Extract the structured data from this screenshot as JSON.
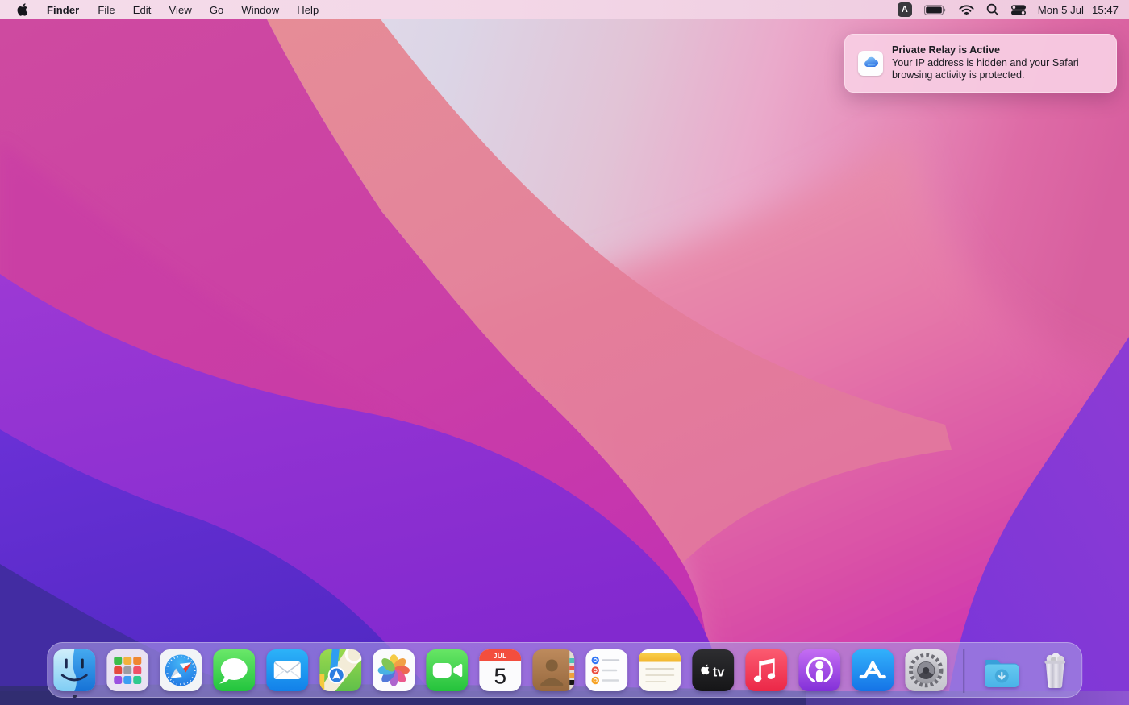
{
  "menu_bar": {
    "active_app": "Finder",
    "menus": [
      "File",
      "Edit",
      "View",
      "Go",
      "Window",
      "Help"
    ],
    "status": {
      "input_source": "A",
      "date": "Mon 5 Jul",
      "time": "15:47"
    }
  },
  "notification": {
    "app": "iCloud",
    "title": "Private Relay is Active",
    "body": "Your IP address is hidden and your Safari browsing activity is protected."
  },
  "dock": {
    "apps": [
      "Finder",
      "Launchpad",
      "Safari",
      "Messages",
      "Mail",
      "Maps",
      "Photos",
      "FaceTime",
      "Calendar",
      "Contacts",
      "Reminders",
      "Notes",
      "Apple TV",
      "Music",
      "Podcasts",
      "App Store",
      "System Preferences",
      "Downloads",
      "Trash"
    ],
    "running_apps": [
      "Finder"
    ],
    "calendar_badge": {
      "month": "JUL",
      "day": "5"
    },
    "appletv_label": "tv"
  },
  "colors": {
    "menubar_pink": "#f3d7e7",
    "notification_pink": "#f7cde3",
    "wallpaper_magenta": "#cc43a3",
    "wallpaper_purple": "#9138d0",
    "wallpaper_violet": "#6331d3",
    "wallpaper_indigo": "#302d6e",
    "dock_tint": "#a798e2"
  }
}
